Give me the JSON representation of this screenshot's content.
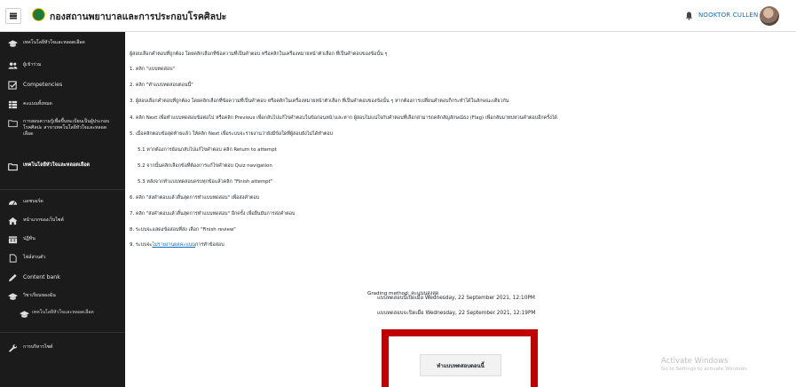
{
  "header": {
    "site_name": "กองสถานพยาบาลและการประกอบโรคศิลปะ",
    "user_name": "NOOKTOR CULLEN"
  },
  "sidebar": {
    "items": [
      {
        "label": "เทคโนโลยีหัวใจและหลอดเลือด",
        "icon": "graduation-cap-icon"
      },
      {
        "label": "ผู้เข้าร่วม",
        "icon": "users-icon"
      },
      {
        "label": "Competencies",
        "icon": "check-square-icon"
      },
      {
        "label": "คะแนนทั้งหมด",
        "icon": "grid-icon"
      },
      {
        "label": "การสอบความรู้เพื่อขึ้นทะเบียนเป็นผู้ประกอบโรคศิลปะ สาขาเทคโนโลยีหัวใจและหลอดเลือด",
        "icon": "folder-icon"
      },
      {
        "label": "เทคโนโลยีหัวใจและหลอดเลือด",
        "icon": "folder-icon"
      },
      {
        "label": "แดชบอร์ด",
        "icon": "dashboard-icon"
      },
      {
        "label": "หน้าแรกของเว็บไซต์",
        "icon": "home-icon"
      },
      {
        "label": "ปฏิทิน",
        "icon": "calendar-icon"
      },
      {
        "label": "ไฟล์ส่วนตัว",
        "icon": "file-icon"
      },
      {
        "label": "Content bank",
        "icon": "pencil-icon"
      },
      {
        "label": "วิชาเรียนของฉัน",
        "icon": "graduation-cap-icon"
      },
      {
        "label": "เทคโนโลยีหัวใจและหลอดเลือด",
        "icon": "graduation-cap-icon"
      },
      {
        "label": "การบริหารไซต์",
        "icon": "wrench-icon"
      }
    ]
  },
  "instructions": [
    "ผู้สอบเลือกคำตอบที่ถูกต้อง โดยคลิกเลือกที่ข้อความที่เป็นคำตอบ หรือคลิกในเครื่องหมายหน้าตัวเลือก ที่เป็นคำตอบของข้อนั้น ๆ",
    "1. คลิก \"แบบทดสอบ\"",
    "2. คลิก \"ทำแบบทดสอบตอนนี้\"",
    "3. ผู้สอบเลือกคำตอบที่ถูกต้อง โดยคลิกเลือกที่ข้อความที่เป็นคำตอบ หรือคลิกในเครื่องหมายหน้าตัวเลือก ที่เป็นคำตอบของข้อนั้น ๆ หากต้องการเปลี่ยนคำตอบก็กระทำได้ในลักษณะเดียวกัน",
    "4. คลิก Next เพื่อทำแบบทดสอบข้อต่อไป หรือคลิก Previous เพื่อกลับไปแก้ไขคำตอบในข้อก่อนหน้าและหาก ผู้สอบไม่แน่ใจกับคำตอบที่เลือกสามารถคลิกสัญลักษณ์ธง (Flag) เพื่อกลับมาทบทวนคำตอบอีกครั้งได้",
    "5. เมื่อคลิกตอบข้อสุดท้ายแล้ว ให้คลิก Next เพื่อระบบจะรายงานว่ายังมีข้อใดที่ผู้สอบยังไม่ได้ทำตอบ"
  ],
  "sub_instructions": [
    "5.1 หากต้องการย้อนกลับไปแก้ไขคำตอบ คลิก Return to attempt",
    "5.2 จากนั้นคลิกเลือกข้อที่ต้องการแก้ไขคำตอบ Quiz navigation",
    "5.3 หลังจากทำแบบทดสอบครบทุกข้อแล้วคลิก \"Finish attempt\""
  ],
  "instructions_2": [
    "6. คลิก \"ส่งคำตอบแล้วสิ้นสุดการทำแบบทดสอบ\" เพื่อส่งคำตอบ",
    "7. คลิก \"ส่งคำตอบแล้วสิ้นสุดการทำแบบทดสอบ\" อีกครั้ง เพื่อยืนยันการส่งคำตอบ",
    "8. ระบบจะแสดงข้อสอบที่ส่ง เลือก \"Finish review\""
  ],
  "final_line": {
    "prefix": "9. ระบบจะ",
    "underlined": "ไม่รายงานผลคะแนน",
    "suffix": "การทำข้อสอบ"
  },
  "quiz_info": {
    "opened": "แบบทดสอบนี้เปิดเมื่อ Wednesday, 22 September 2021, 12:10PM",
    "closed": "แบบทดสอบจะปิดเมื่อ Wednesday, 22 September 2021, 12:19PM",
    "grading_method": "Grading method: คะแนนสูงสุด"
  },
  "attempt_button": "ทำแบบทดสอบตอนนี้",
  "watermark": {
    "line1": "Activate Windows",
    "line2": "Go to Settings to activate Windows."
  },
  "colors": {
    "sidebar_bg": "#1b1b1b",
    "highlight_border": "#c00000",
    "link": "#0f6cbf"
  }
}
